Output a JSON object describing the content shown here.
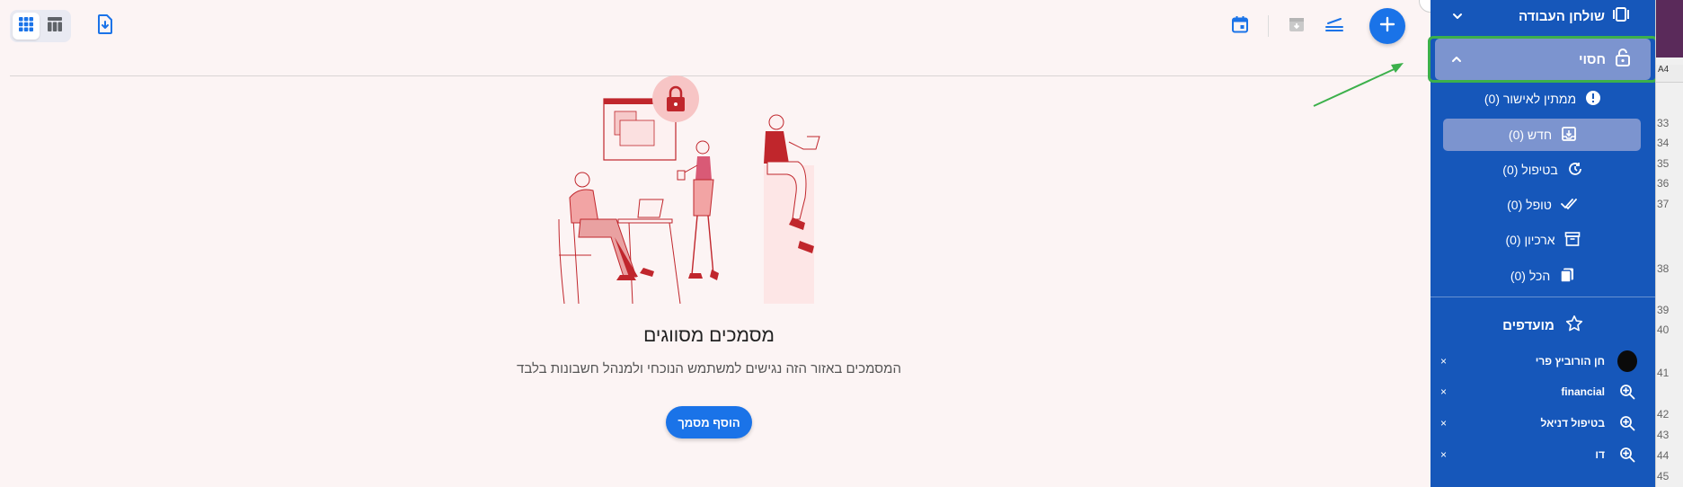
{
  "toolbar": {
    "grid_view_icon": "grid-icon",
    "table_view_icon": "table-icon",
    "download_icon": "file-download-icon",
    "calendar_icon": "calendar-icon",
    "archive_icon": "archive-icon",
    "scanner_icon": "scanner-icon",
    "add_icon": "plus-icon"
  },
  "empty_state": {
    "title": "מסמכים מסווגים",
    "subtitle": "המסמכים באזור הזה נגישים למשתמש הנוכחי ולמנהל חשבונות בלבד",
    "add_button": "הוסף מסמך"
  },
  "sidebar": {
    "workspace_label": "שולחן העבודה",
    "secure_label": "חסוי",
    "items": [
      {
        "label": "ממתין לאישור (0)",
        "icon": "alert-circle-icon"
      },
      {
        "label": "חדש (0)",
        "icon": "inbox-icon"
      },
      {
        "label": "בטיפול (0)",
        "icon": "clock-rotate-icon"
      },
      {
        "label": "טופל (0)",
        "icon": "double-check-icon"
      },
      {
        "label": "ארכיון (0)",
        "icon": "archive-box-icon"
      },
      {
        "label": "הכל (0)",
        "icon": "copy-icon"
      }
    ],
    "favorites_label": "מועדפים",
    "favorites": [
      {
        "label": "חן הורוביץ פרי",
        "icon": "avatar"
      },
      {
        "label": "financial",
        "icon": "search-plus-icon"
      },
      {
        "label": "בטיפול דניאל",
        "icon": "search-plus-icon"
      },
      {
        "label": "דו",
        "icon": "search-plus-icon"
      }
    ],
    "remove_symbol": "×"
  },
  "background_strip": {
    "tab_text": "A4",
    "row_numbers": [
      "33",
      "34",
      "35",
      "36",
      "37",
      "38",
      "39",
      "40",
      "41",
      "42",
      "43",
      "44",
      "45"
    ]
  },
  "colors": {
    "accent": "#1a73e8",
    "sidebar": "#1657ba",
    "sidebar_active": "#7c94cf",
    "highlight_box": "#3cb04b",
    "illustration_red": "#c0262c",
    "illustration_pink": "#f2a4a4"
  }
}
